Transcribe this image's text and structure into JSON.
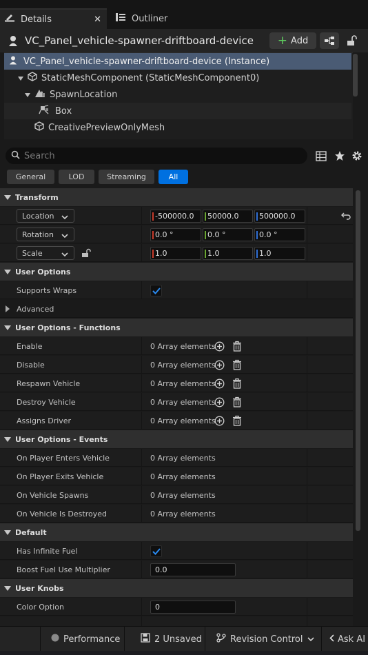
{
  "tabs": [
    {
      "label": "Details",
      "icon": "details-pencil-icon",
      "active": true
    },
    {
      "label": "Outliner",
      "icon": "outliner-icon",
      "active": false
    }
  ],
  "header": {
    "title": "VC_Panel_vehicle-spawner-driftboard-device",
    "add_label": "Add"
  },
  "tree": [
    {
      "label": "VC_Panel_vehicle-spawner-driftboard-device (Instance)",
      "icon": "actor-icon",
      "selected": true
    },
    {
      "label": "StaticMeshComponent (StaticMeshComponent0)",
      "icon": "static-mesh-icon"
    },
    {
      "label": "SpawnLocation",
      "icon": "spawn-location-icon"
    },
    {
      "label": "Box",
      "icon": "box-component-icon"
    },
    {
      "label": "CreativePreviewOnlyMesh",
      "icon": "static-mesh-icon"
    }
  ],
  "search": {
    "placeholder": "Search"
  },
  "filters": [
    "General",
    "LOD",
    "Streaming",
    "All"
  ],
  "active_filter": "All",
  "sections": {
    "transform": {
      "title": "Transform",
      "rows": [
        {
          "label": "Location",
          "x": "-500000.0",
          "y": "50000.0",
          "z": "500000.0"
        },
        {
          "label": "Rotation",
          "x": "0.0 °",
          "y": "0.0 °",
          "z": "0.0 °"
        },
        {
          "label": "Scale",
          "x": "1.0",
          "y": "1.0",
          "z": "1.0"
        }
      ]
    },
    "user_options": {
      "title": "User Options",
      "supports_wraps_label": "Supports Wraps",
      "supports_wraps": true,
      "advanced_label": "Advanced"
    },
    "functions": {
      "title": "User Options - Functions",
      "rows": [
        {
          "label": "Enable",
          "value": "0 Array elements"
        },
        {
          "label": "Disable",
          "value": "0 Array elements"
        },
        {
          "label": "Respawn Vehicle",
          "value": "0 Array elements"
        },
        {
          "label": "Destroy Vehicle",
          "value": "0 Array elements"
        },
        {
          "label": "Assigns Driver",
          "value": "0 Array elements"
        }
      ]
    },
    "events": {
      "title": "User Options - Events",
      "rows": [
        {
          "label": "On Player Enters Vehicle",
          "value": "0 Array elements"
        },
        {
          "label": "On Player Exits Vehicle",
          "value": "0 Array elements"
        },
        {
          "label": "On Vehicle Spawns",
          "value": "0 Array elements"
        },
        {
          "label": "On Vehicle Is Destroyed",
          "value": "0 Array elements"
        }
      ]
    },
    "default": {
      "title": "Default",
      "infinite_fuel_label": "Has Infinite Fuel",
      "infinite_fuel": true,
      "boost_label": "Boost Fuel Use Multiplier",
      "boost_value": "0.0"
    },
    "knobs": {
      "title": "User Knobs",
      "color_option_label": "Color Option",
      "color_option_value": "0"
    }
  },
  "status": {
    "performance": "Performance",
    "unsaved": "2 Unsaved",
    "revision": "Revision Control",
    "ask_ai": "Ask AI"
  },
  "colors": {
    "accent": "#0070e0",
    "x_axis": "#c83b2b",
    "y_axis": "#6aa532",
    "z_axis": "#2f6fd6",
    "selected_row": "#4a5b74",
    "check": "#2a8bf2"
  }
}
